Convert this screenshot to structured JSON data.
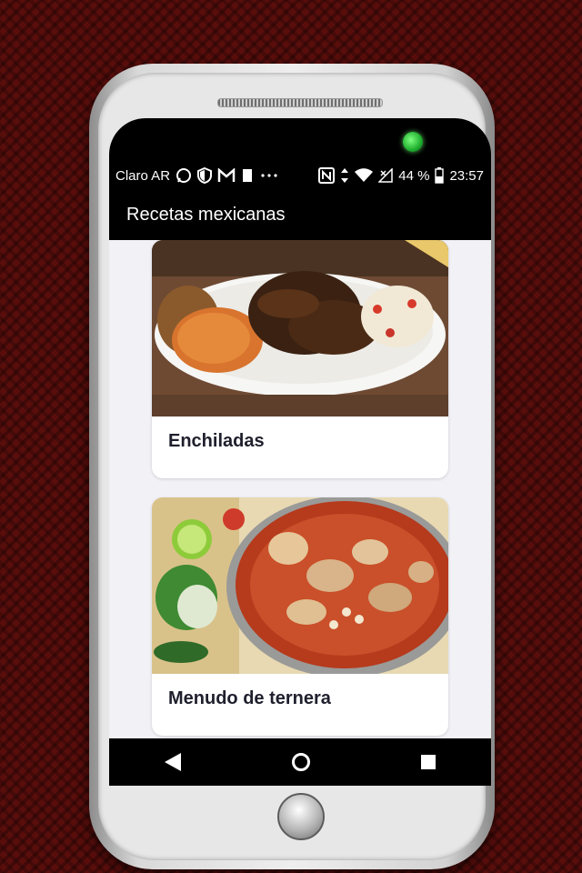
{
  "statusbar": {
    "carrier": "Claro AR",
    "battery": "44 %",
    "time": "23:57",
    "left_icons": [
      "whatsapp-icon",
      "shield-icon",
      "gmail-icon",
      "notification-icon",
      "more-dots-icon"
    ],
    "right_icons": [
      "nfc-icon",
      "data-arrows-icon",
      "wifi-icon",
      "no-signal-icon",
      "battery-icon"
    ]
  },
  "appbar": {
    "title": "Recetas mexicanas"
  },
  "recipes": [
    {
      "name": "Enchiladas"
    },
    {
      "name": "Menudo de ternera"
    }
  ],
  "navbar": {
    "buttons": [
      "back-icon",
      "home-icon",
      "recents-icon"
    ]
  },
  "colors": {
    "background": "#5a0e0c",
    "appbar": "#000000",
    "content": "#f1f1f6",
    "camera_led": "#2ecc40"
  }
}
